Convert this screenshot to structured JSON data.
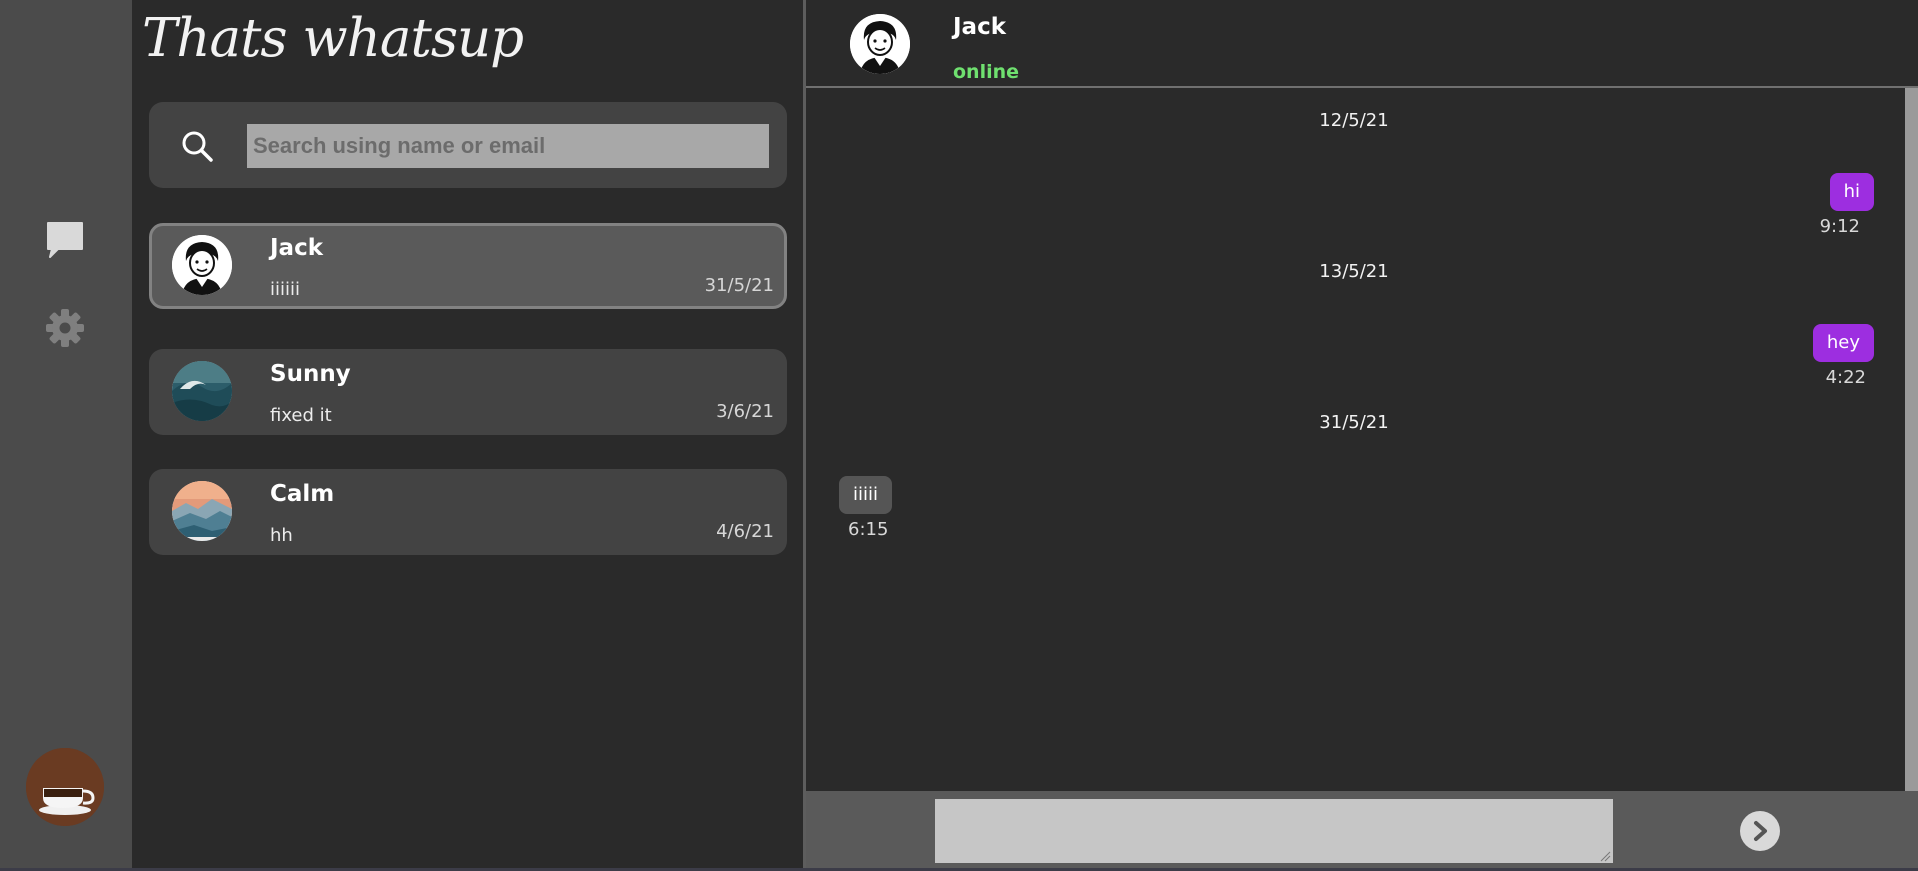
{
  "app": {
    "title": "Thats whatsup"
  },
  "search": {
    "placeholder": "Search using name or email"
  },
  "rail": {
    "icons": [
      "chat-bubble-icon",
      "gear-icon"
    ],
    "profile_avatar": "coffee-cup-avatar"
  },
  "chats": [
    {
      "name": "Jack",
      "last_message": "iiiiii",
      "date": "31/5/21",
      "active": true,
      "avatar": "cartoon-man-avatar"
    },
    {
      "name": "Sunny",
      "last_message": "fixed it",
      "date": "3/6/21",
      "active": false,
      "avatar": "ocean-wave-avatar"
    },
    {
      "name": "Calm",
      "last_message": "hh",
      "date": "4/6/21",
      "active": false,
      "avatar": "misty-mountains-avatar"
    }
  ],
  "conversation": {
    "contact_name": "Jack",
    "status": "online",
    "messages": [
      {
        "date": "12/5/21",
        "text": "hi",
        "time": "9:12",
        "direction": "out"
      },
      {
        "date": "13/5/21",
        "text": "hey",
        "time": "4:22",
        "direction": "out"
      },
      {
        "date": "31/5/21",
        "text": "iiiii",
        "time": "6:15",
        "direction": "in"
      }
    ]
  },
  "composer": {
    "value": ""
  },
  "colors": {
    "accent": "#9d2ee0",
    "online": "#6fe06f",
    "background": "#2a2a2a",
    "rail": "#4b4b4b",
    "card": "#434343"
  }
}
